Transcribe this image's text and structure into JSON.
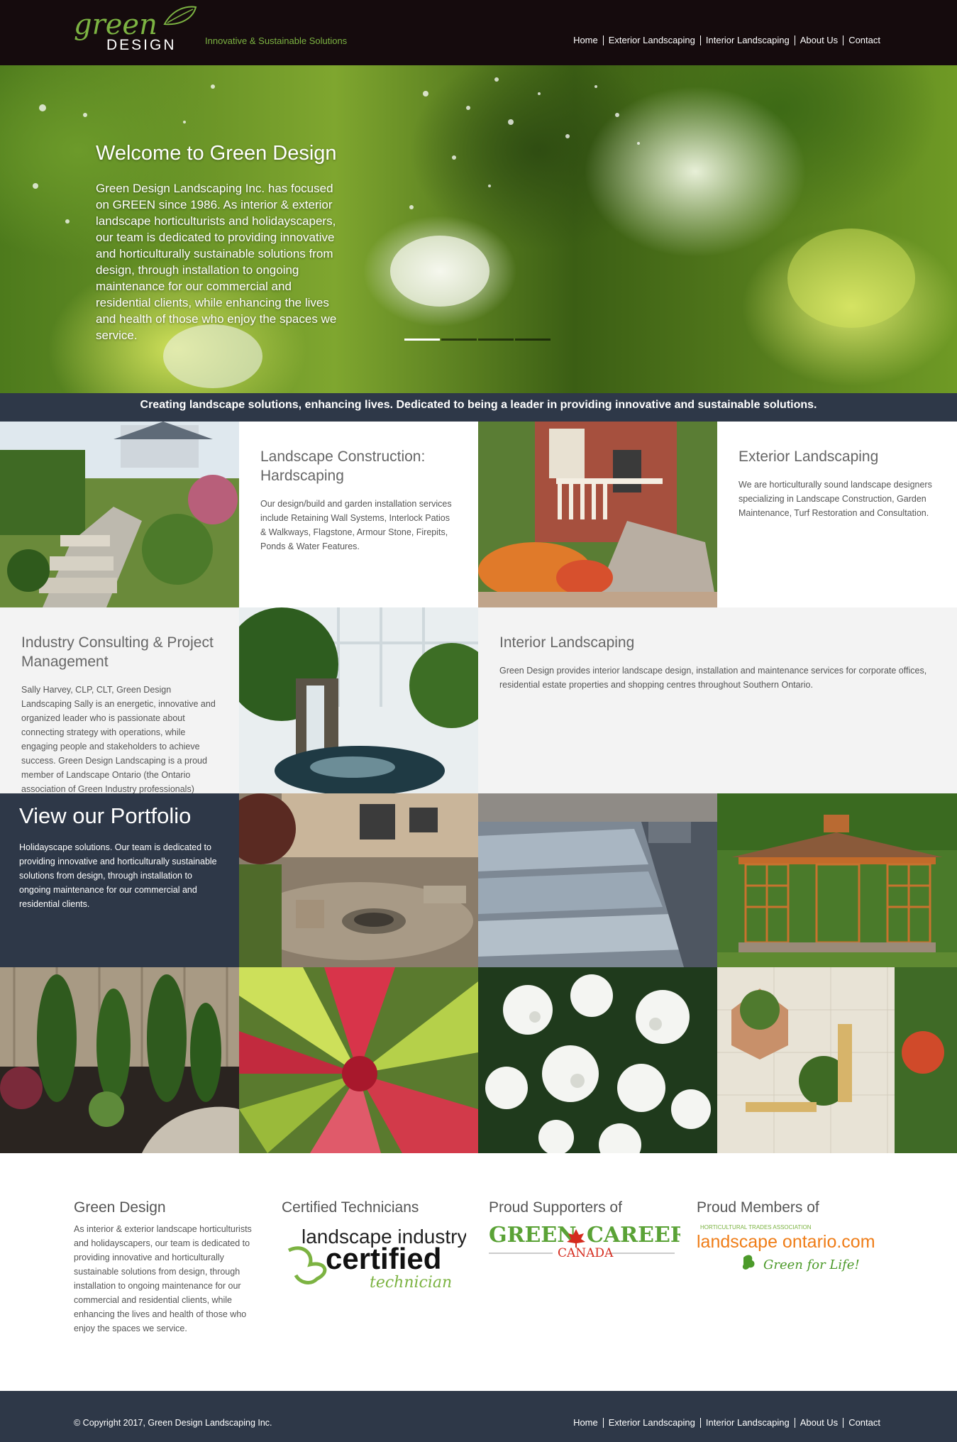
{
  "header": {
    "logo_script": "green",
    "logo_word": "DESIGN",
    "tagline": "Innovative & Sustainable Solutions",
    "nav": [
      "Home",
      "Exterior Landscaping",
      "Interior Landscaping",
      "About Us",
      "Contact"
    ]
  },
  "hero": {
    "title": "Welcome to Green Design",
    "text": "Green Design Landscaping Inc. has focused on GREEN since 1986. As interior & exterior landscape horticulturists and holidayscapers, our team is dedicated to providing innovative and horticulturally sustainable solutions from design, through installation to ongoing maintenance for our commercial and residential clients, while enhancing the lives and health of those who enjoy the spaces we service.",
    "slides": 4,
    "active_slide": 1
  },
  "banner": {
    "text": "Creating landscape solutions, enhancing lives. Dedicated to being a leader in providing innovative and sustainable solutions."
  },
  "tiles": {
    "hardscaping": {
      "title": "Landscape Construction: Hardscaping",
      "body": "Our design/build and garden installation services include Retaining Wall Systems, Interlock Patios & Walkways, Flagstone, Armour Stone, Firepits, Ponds & Water Features."
    },
    "exterior": {
      "title": "Exterior Landscaping",
      "body": "We are horticulturally sound landscape designers specializing in Landscape Construction, Garden Maintenance, Turf Restoration and Consultation."
    },
    "consulting": {
      "title": "Industry Consulting & Project Management",
      "body": "Sally Harvey, CLP, CLT, Green Design Landscaping Sally is an energetic, innovative and organized leader who is passionate about connecting strategy with operations, while engaging people and stakeholders to achieve success. Green Design Landscaping is a proud member of Landscape Ontario (the Ontario association of Green Industry professionals)"
    },
    "interior": {
      "title": "Interior Landscaping",
      "body": "Green Design provides interior landscape design, installation and maintenance services for corporate offices, residential estate properties and shopping centres throughout Southern Ontario."
    },
    "portfolio": {
      "title": "View our Portfolio",
      "body": "Holidayscape solutions. Our team is dedicated to providing innovative and horticulturally sustainable solutions from design, through installation to ongoing maintenance for our commercial and residential clients."
    }
  },
  "footer": {
    "about": {
      "title": "Green Design",
      "body": "As interior & exterior landscape horticulturists and holidayscapers, our team is dedicated to providing innovative and horticulturally sustainable solutions from design, through installation to ongoing maintenance for our commercial and residential clients, while enhancing the lives and health of those who enjoy the spaces we service."
    },
    "certified": {
      "title": "Certified Technicians",
      "logo_line1": "landscape industry",
      "logo_line2": "certified",
      "logo_line3": "technician"
    },
    "supporters": {
      "title": "Proud Supporters of",
      "logo_left": "GREEN",
      "logo_right": "CAREERS",
      "logo_sub": "CANADA"
    },
    "members": {
      "title": "Proud Members of",
      "logo_top": "HORTICULTURAL TRADES ASSOCIATION",
      "logo_main": "landscape ontario.com",
      "logo_slogan": "Green for Life!"
    },
    "copyright": "© Copyright 2017, Green Design Landscaping Inc.",
    "nav": [
      "Home",
      "Exterior Landscaping",
      "Interior Landscaping",
      "About Us",
      "Contact"
    ]
  },
  "colors": {
    "header_bg": "#150b0d",
    "accent_green": "#7cb342",
    "navy": "#2e3848",
    "tile_light": "#f3f3f3"
  }
}
